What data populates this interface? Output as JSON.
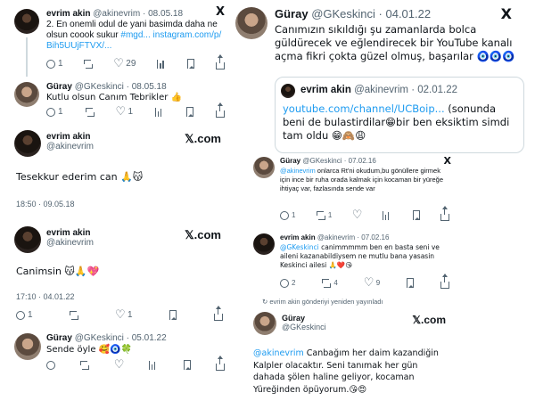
{
  "p1": {
    "name": "evrim akin",
    "handle": "@akinevrim",
    "date": "· 08.05.18",
    "text": "2. En onemli odul de yani basimda daha ne olsun coook sukur",
    "hashtag": "#mgd...",
    "link1": "instagram.com/p/",
    "link2": "Bih5UUjFTVX/...",
    "stats": {
      "reply": "1",
      "like": "29"
    }
  },
  "p2": {
    "name": "Güray",
    "handle": "@GKeskinci",
    "date": "· 08.05.18",
    "text": "Kutlu olsun Canım Tebrikler 👍",
    "stats": {
      "reply": "1",
      "like": "1"
    }
  },
  "p3": {
    "name": "evrim akin",
    "handle": "@akinevrim",
    "brand": "𝕏.com",
    "text": "Tesekkur ederim can 🙏😽",
    "meta": "18:50 · 09.05.18"
  },
  "p4": {
    "name": "evrim akin",
    "handle": "@akinevrim",
    "brand": "𝕏.com",
    "text": "Canimsin 😽🙏💖",
    "meta": "17:10 · 04.01.22",
    "stats": {
      "reply": "1",
      "like": "1"
    }
  },
  "p5": {
    "name": "Güray",
    "handle": "@GKeskinci",
    "date": "· 05.01.22",
    "text": "Sende öyle 🥰🧿🍀"
  },
  "p6": {
    "name": "Güray",
    "handle": "@GKeskinci",
    "date": "· 04.01.22",
    "text": "Canımızın sıkıldığı şu zamanlarda bolca güldürecek ve eğlendirecek bir YouTube kanalı açma fikri çokta güzel olmuş, başarılar 🧿🧿🧿",
    "quote": {
      "name": "evrim akin",
      "handle": "@akinevrim",
      "date": "· 02.01.22",
      "link": "youtube.com/channel/UCBoip...",
      "text": " (sonunda beni de bulastirdilar😁bir ben eksiktim simdi tam oldu 😁🙈😩"
    }
  },
  "p7": {
    "name": "Güray",
    "handle": "@GKeskinci",
    "date": "· 07.02.16",
    "mention": "@akinevrim",
    "text": " onlarca Rt'ni okudum,bu gönüllere girmek için ince bir ruha orada kalmak için kocaman bir yüreğe ihtiyaç var, fazlasında sende var",
    "stats": {
      "reply": "1",
      "rt": "1"
    }
  },
  "p8": {
    "name": "evrim akin",
    "handle": "@akinevrim",
    "date": "· 07.02.16",
    "mention": "@GKeskinci",
    "text": " canimmmmm ben en basta seni ve aileni kazanabildiysem ne mutlu bana yasasin Keskinci ailesi 🙏❤️😘",
    "stats": {
      "reply": "2",
      "rt": "4",
      "like": "9"
    }
  },
  "repost_note": "evrim akin gönderiyi yeniden yayınladı",
  "p9": {
    "name": "Güray",
    "handle": "@GKeskinci",
    "brand": "𝕏.com",
    "mention": "@akinevrim",
    "text": " Canbağım her daim kazandiğin Kalpler olacaktır. Seni tanımak her gün dahada şölen haline geliyor, kocaman Yüreğinden öpüyorum.😘😍"
  }
}
